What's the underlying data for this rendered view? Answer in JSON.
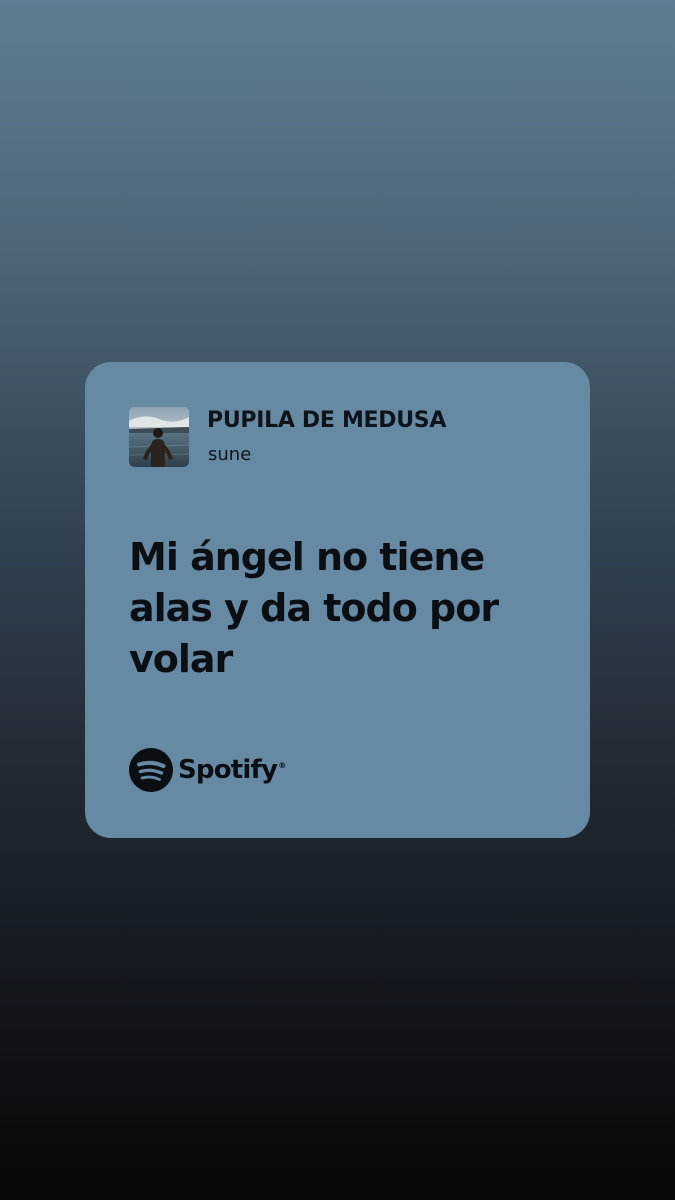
{
  "card": {
    "background": "#678aa4",
    "track_title": "PUPILA DE MEDUSA",
    "artist": "sune",
    "lyrics": [
      "Mi ángel no tiene",
      "alas y da todo por",
      "volar"
    ],
    "brand": {
      "name": "Spotify",
      "icon": "spotify-logo-icon"
    },
    "cover": {
      "icon": "album-cover-person-by-lake"
    }
  },
  "colors": {
    "text": "#0b0f13",
    "background_top": "#5f7d92",
    "background_bottom": "#060709"
  }
}
